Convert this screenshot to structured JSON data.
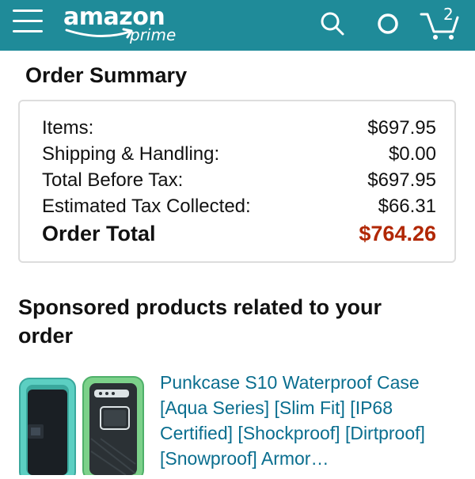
{
  "header": {
    "logo_word": "amazon",
    "logo_prime": "prime",
    "cart_count": "2",
    "icons": [
      "menu-icon",
      "search-icon",
      "alexa-icon",
      "cart-icon"
    ],
    "colors": {
      "header_bg": "#1f8b99"
    }
  },
  "summary": {
    "title": "Order Summary",
    "rows": [
      {
        "label": "Items:",
        "value": "$697.95"
      },
      {
        "label": "Shipping & Handling:",
        "value": "$0.00"
      },
      {
        "label": "Total Before Tax:",
        "value": "$697.95"
      },
      {
        "label": "Estimated Tax Collected:",
        "value": "$66.31"
      }
    ],
    "total": {
      "label": "Order Total",
      "value": "$764.26",
      "color": "#b12704"
    }
  },
  "sponsored": {
    "title": "Sponsored products related to your order",
    "product": {
      "title": "Punkcase S10 Waterproof Case [Aqua Series] [Slim Fit] [IP68 Certified] [Shockproof] [Dirtproof] [Snowproof] Armor…"
    }
  }
}
